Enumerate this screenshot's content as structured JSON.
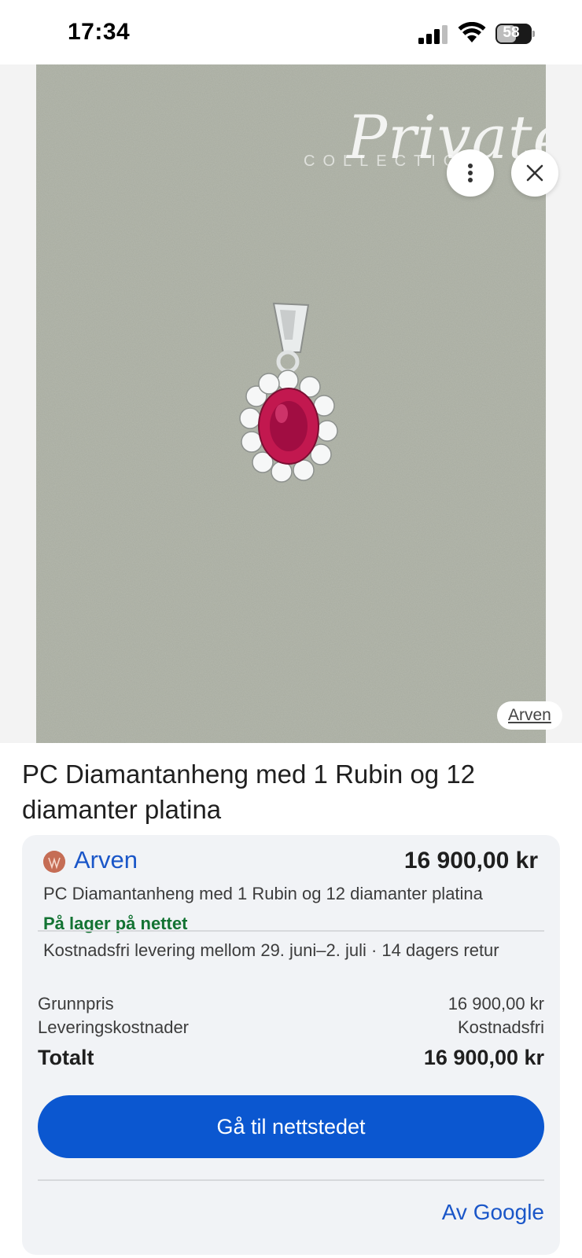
{
  "status_bar": {
    "time": "17:34",
    "battery_percent": "58",
    "battery_level": 0.58
  },
  "image_viewer": {
    "watermark_script": "Private",
    "watermark_sub": "COLLECTION",
    "source_label": "Arven",
    "more_icon": "more-vert-icon",
    "close_icon": "close-icon"
  },
  "product": {
    "title": "PC Diamantanheng med 1 Rubin og 12 diamanter platina"
  },
  "offer": {
    "merchant_name": "Arven",
    "price": "16 900,00 kr",
    "description": "PC Diamantanheng med 1 Rubin og 12 diamanter platina",
    "stock_status": "På lager på nettet",
    "delivery": "Kostnadsfri levering mellom 29. juni–2. juli · 14 dagers retur",
    "rows": [
      {
        "label": "Grunnpris",
        "value": "16 900,00 kr"
      },
      {
        "label": "Leveringskostnader",
        "value": "Kostnadsfri"
      }
    ],
    "total_label": "Totalt",
    "total_value": "16 900,00 kr",
    "cta_label": "Gå til nettstedet",
    "footer_link": "Av Google"
  },
  "colors": {
    "accent_blue": "#0b57d0",
    "link_blue": "#1a56c8",
    "stock_green": "#137333",
    "card_bg": "#f1f3f6"
  }
}
